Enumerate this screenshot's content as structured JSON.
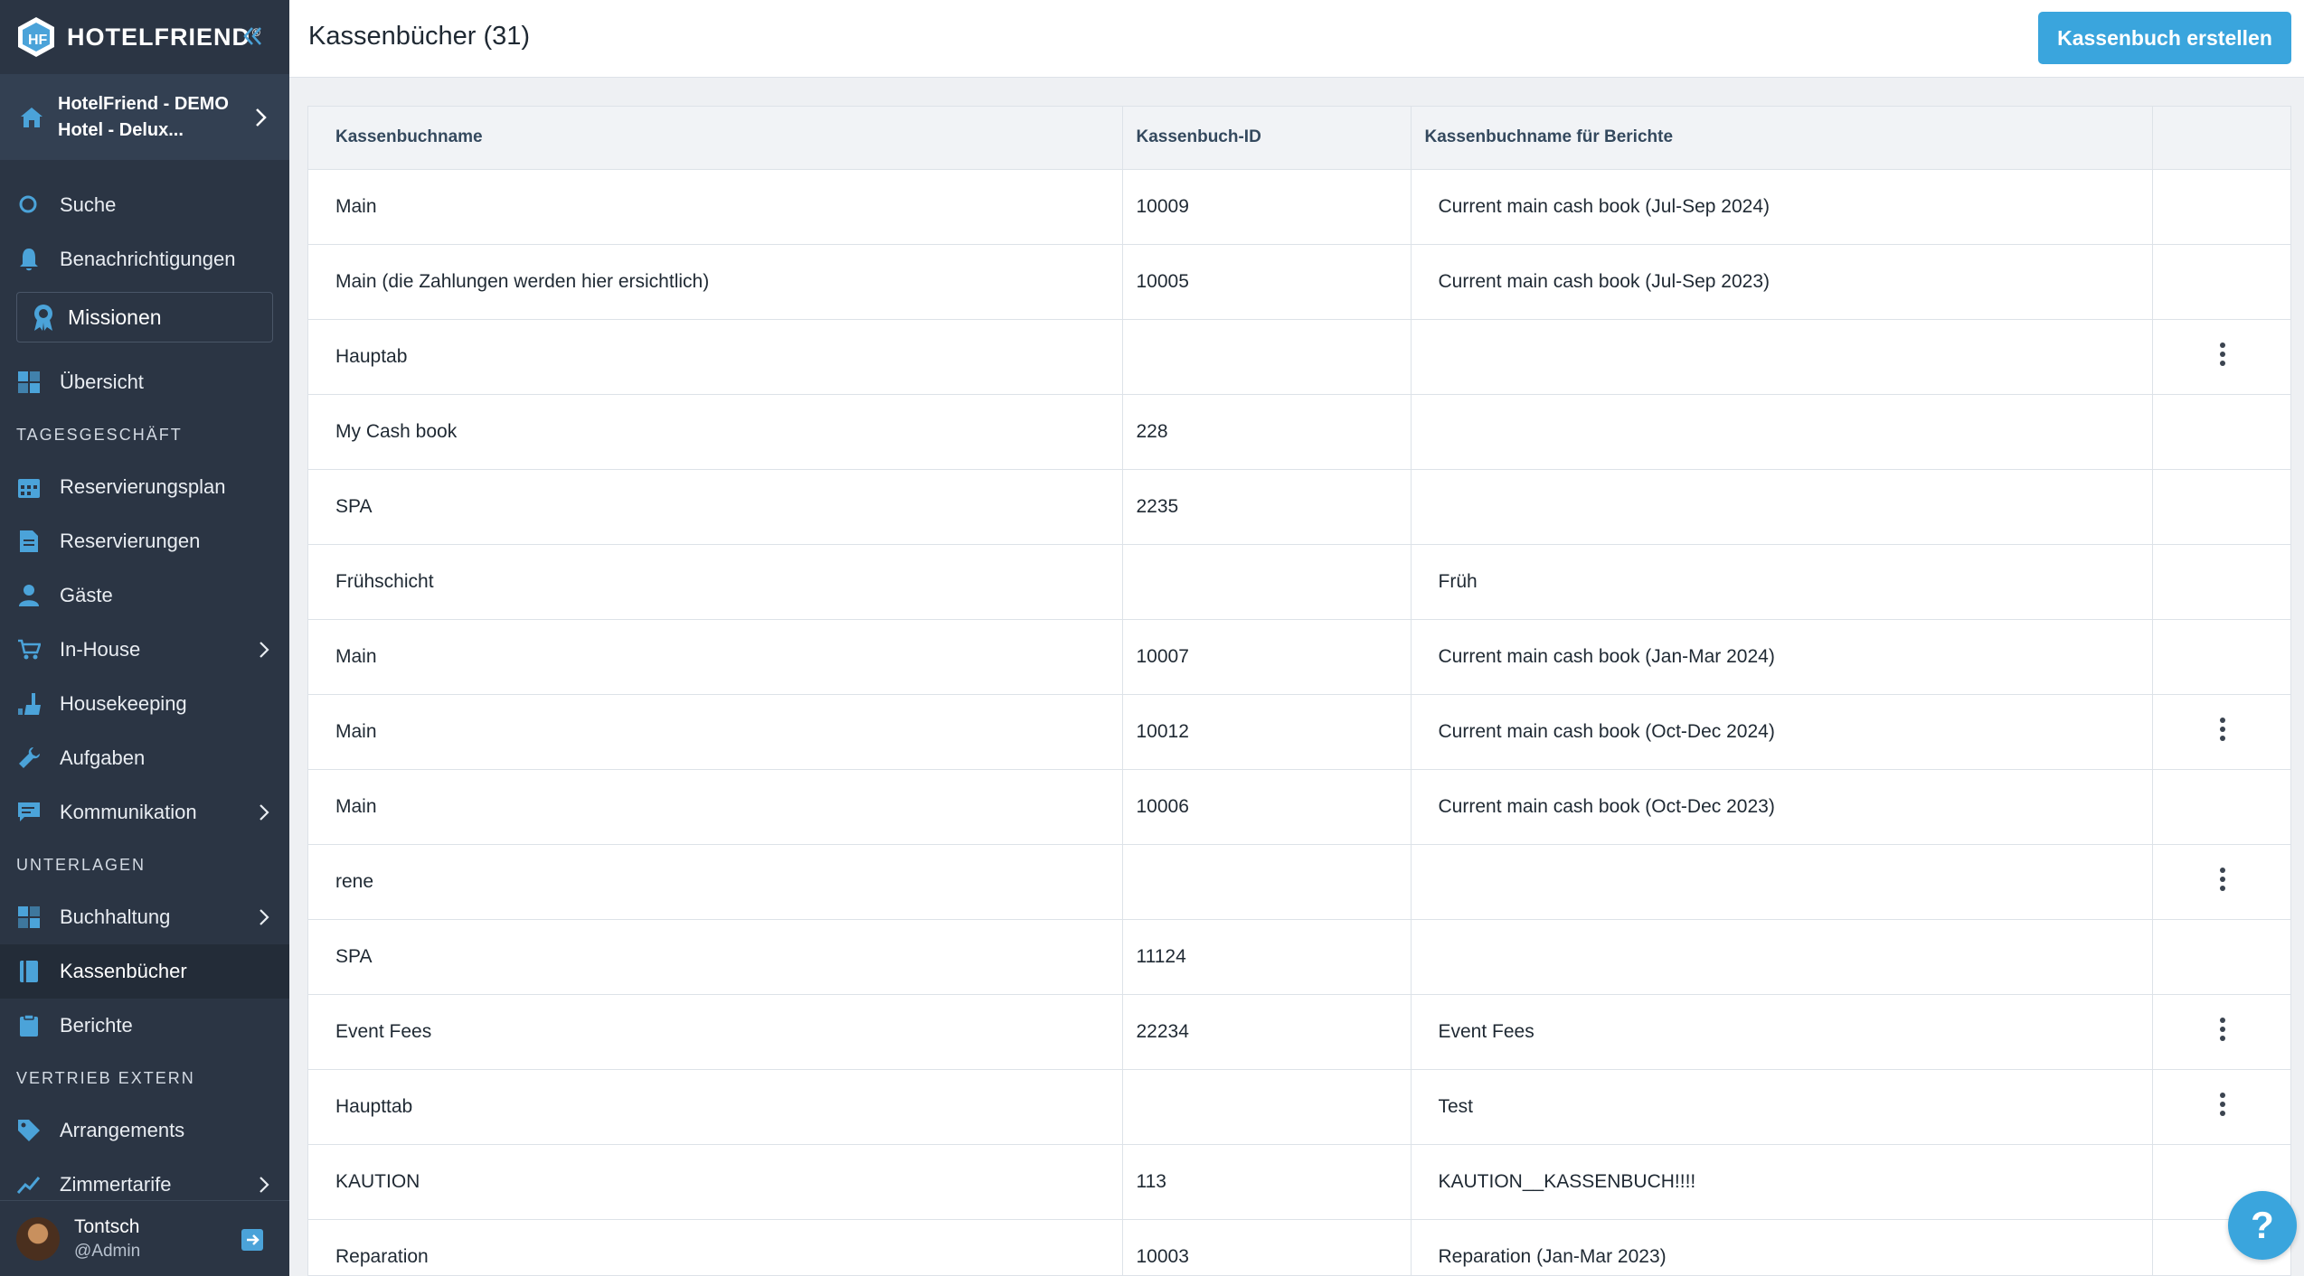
{
  "brand": {
    "name": "HOTELFRIEND",
    "registered": "®"
  },
  "hotel": {
    "name": "HotelFriend - DEMO Hotel - Delux..."
  },
  "nav": {
    "search": "Suche",
    "notifications": "Benachrichtigungen",
    "missions": "Missionen",
    "overview": "Übersicht",
    "section_daily": "TAGESGESCHÄFT",
    "reservation_plan": "Reservierungsplan",
    "reservations": "Reservierungen",
    "guests": "Gäste",
    "in_house": "In-House",
    "housekeeping": "Housekeeping",
    "tasks": "Aufgaben",
    "communication": "Kommunikation",
    "section_documents": "UNTERLAGEN",
    "accounting": "Buchhaltung",
    "cashbooks": "Kassenbücher",
    "reports": "Berichte",
    "section_distribution": "VERTRIEB EXTERN",
    "arrangements": "Arrangements",
    "room_rates": "Zimmertarife"
  },
  "user": {
    "name": "Tontsch",
    "role": "@Admin"
  },
  "page": {
    "title": "Kassenbücher (31)",
    "create_button": "Kassenbuch erstellen"
  },
  "table": {
    "columns": [
      "Kassenbuchname",
      "Kassenbuch-ID",
      "Kassenbuchname für Berichte",
      ""
    ],
    "rows": [
      {
        "name": "Main",
        "id": "10009",
        "report_name": "Current main cash book (Jul-Sep 2024)",
        "menu": false
      },
      {
        "name": "Main (die Zahlungen werden hier ersichtlich)",
        "id": "10005",
        "report_name": "Current main cash book (Jul-Sep 2023)",
        "menu": false
      },
      {
        "name": "Hauptab",
        "id": "",
        "report_name": "",
        "menu": true
      },
      {
        "name": "My Cash book",
        "id": "228",
        "report_name": "",
        "menu": false
      },
      {
        "name": "SPA",
        "id": "2235",
        "report_name": "",
        "menu": false
      },
      {
        "name": "Frühschicht",
        "id": "",
        "report_name": "Früh",
        "menu": false
      },
      {
        "name": "Main",
        "id": "10007",
        "report_name": "Current main cash book (Jan-Mar 2024)",
        "menu": false
      },
      {
        "name": "Main",
        "id": "10012",
        "report_name": "Current main cash book (Oct-Dec 2024)",
        "menu": true
      },
      {
        "name": "Main",
        "id": "10006",
        "report_name": "Current main cash book (Oct-Dec 2023)",
        "menu": false
      },
      {
        "name": "rene",
        "id": "",
        "report_name": "",
        "menu": true
      },
      {
        "name": "SPA",
        "id": "11124",
        "report_name": "",
        "menu": false
      },
      {
        "name": "Event Fees",
        "id": "22234",
        "report_name": "Event Fees",
        "menu": true
      },
      {
        "name": "Haupttab",
        "id": "",
        "report_name": "Test",
        "menu": true
      },
      {
        "name": "KAUTION",
        "id": "113",
        "report_name": "KAUTION__KASSENBUCH!!!!",
        "menu": false
      },
      {
        "name": "Reparation",
        "id": "10003",
        "report_name": "Reparation (Jan-Mar 2023)",
        "menu": false
      }
    ]
  },
  "help": {
    "label": "?"
  },
  "colors": {
    "sidebar": "#2b3544",
    "accent": "#3aa5dd",
    "icon_blue": "#4ba3d9"
  }
}
